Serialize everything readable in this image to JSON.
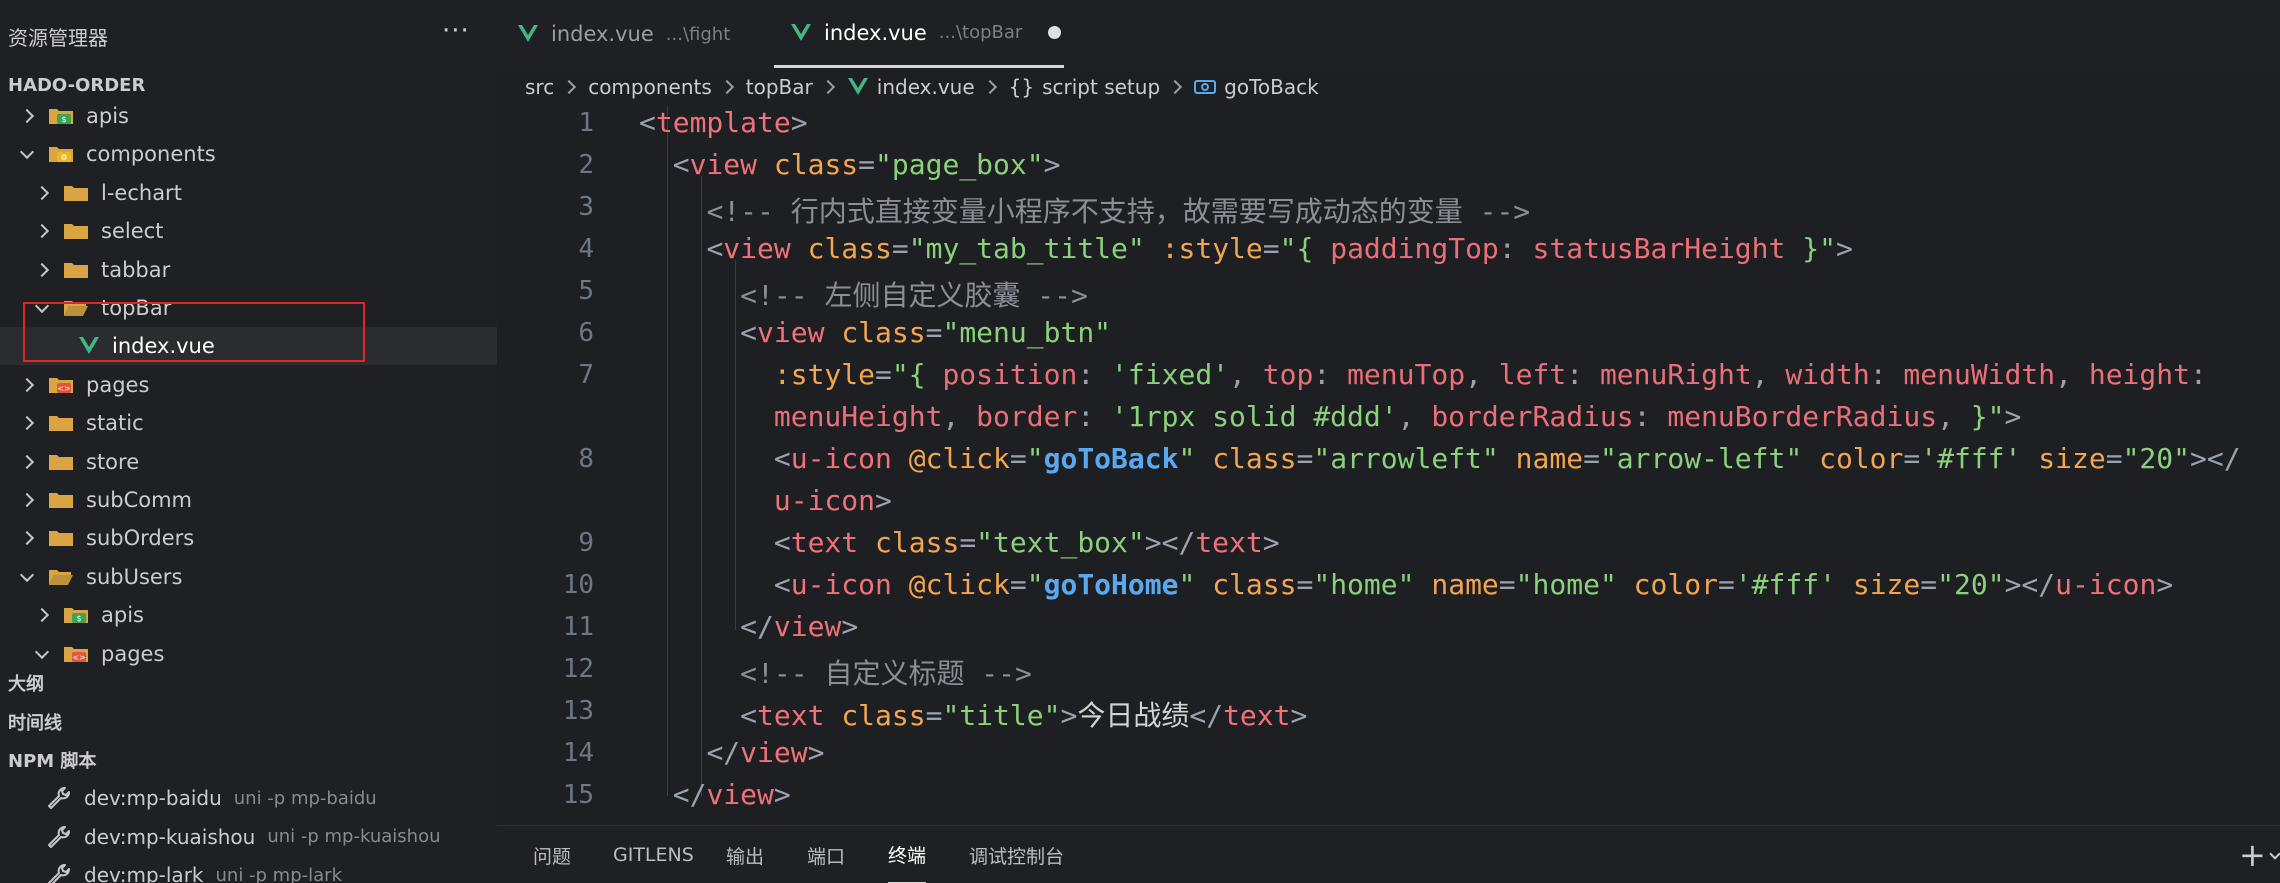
{
  "sidebar": {
    "title": "资源管理器",
    "more_icon": "ellipsis-icon",
    "project": "HADO-ORDER",
    "tree": [
      {
        "label": "apis",
        "kind": "api-folder",
        "open": false,
        "depth": 0
      },
      {
        "label": "components",
        "kind": "component-folder",
        "open": true,
        "depth": 0
      },
      {
        "label": "l-echart",
        "kind": "folder",
        "open": false,
        "depth": 1
      },
      {
        "label": "select",
        "kind": "folder",
        "open": false,
        "depth": 1
      },
      {
        "label": "tabbar",
        "kind": "folder",
        "open": false,
        "depth": 1
      },
      {
        "label": "topBar",
        "kind": "folder-open",
        "open": true,
        "depth": 1
      },
      {
        "label": "index.vue",
        "kind": "vue-file",
        "open": null,
        "depth": 2
      },
      {
        "label": "pages",
        "kind": "pages-folder",
        "open": false,
        "depth": 0
      },
      {
        "label": "static",
        "kind": "folder",
        "open": false,
        "depth": 0
      },
      {
        "label": "store",
        "kind": "folder",
        "open": false,
        "depth": 0
      },
      {
        "label": "subComm",
        "kind": "folder",
        "open": false,
        "depth": 0
      },
      {
        "label": "subOrders",
        "kind": "folder",
        "open": false,
        "depth": 0
      },
      {
        "label": "subUsers",
        "kind": "folder-open",
        "open": true,
        "depth": 0
      },
      {
        "label": "apis",
        "kind": "api-folder",
        "open": false,
        "depth": 1
      },
      {
        "label": "pages",
        "kind": "pages-folder",
        "open": true,
        "depth": 1
      }
    ],
    "sections": {
      "outline": "大纲",
      "timeline": "时间线",
      "npm": "NPM 脚本"
    },
    "npm_scripts": [
      {
        "name": "dev:mp-baidu",
        "cmd": "uni -p mp-baidu"
      },
      {
        "name": "dev:mp-kuaishou",
        "cmd": "uni -p mp-kuaishou"
      },
      {
        "name": "dev:mp-lark",
        "cmd": "uni -p mp-lark"
      }
    ]
  },
  "tabs": [
    {
      "name": "index.vue",
      "desc": "...\\fight",
      "active": false
    },
    {
      "name": "index.vue",
      "desc": "...\\topBar",
      "active": true,
      "dirty": true
    }
  ],
  "breadcrumb": {
    "parts": [
      "src",
      "components",
      "topBar"
    ],
    "file": "index.vue",
    "block": "script setup",
    "block_icon": "{}",
    "symbol": "goToBack"
  },
  "code_lines": [
    {
      "n": "1",
      "segs": [
        [
          "p",
          "<"
        ],
        [
          "t",
          "template"
        ],
        [
          "p",
          ">"
        ]
      ]
    },
    {
      "n": "2",
      "segs": [
        [
          "x",
          "  "
        ],
        [
          "p",
          "<"
        ],
        [
          "t",
          "view"
        ],
        [
          "x",
          " "
        ],
        [
          "a",
          "class"
        ],
        [
          "p",
          "="
        ],
        [
          "s",
          "\"page_box\""
        ],
        [
          "p",
          ">"
        ]
      ]
    },
    {
      "n": "3",
      "segs": [
        [
          "x",
          "    "
        ],
        [
          "c",
          "<!-- 行内式直接变量小程序不支持，故需要写成动态的变量 -->"
        ]
      ]
    },
    {
      "n": "4",
      "segs": [
        [
          "x",
          "    "
        ],
        [
          "p",
          "<"
        ],
        [
          "t",
          "view"
        ],
        [
          "x",
          " "
        ],
        [
          "a",
          "class"
        ],
        [
          "p",
          "="
        ],
        [
          "s",
          "\"my_tab_title\""
        ],
        [
          "x",
          " "
        ],
        [
          "a",
          ":style"
        ],
        [
          "p",
          "="
        ],
        [
          "s",
          "\"{ "
        ],
        [
          "v",
          "paddingTop"
        ],
        [
          "p",
          ": "
        ],
        [
          "v",
          "statusBarHeight"
        ],
        [
          "s",
          " }\""
        ],
        [
          "p",
          ">"
        ]
      ]
    },
    {
      "n": "5",
      "segs": [
        [
          "x",
          "      "
        ],
        [
          "c",
          "<!-- 左侧自定义胶囊 -->"
        ]
      ]
    },
    {
      "n": "6",
      "segs": [
        [
          "x",
          "      "
        ],
        [
          "p",
          "<"
        ],
        [
          "t",
          "view"
        ],
        [
          "x",
          " "
        ],
        [
          "a",
          "class"
        ],
        [
          "p",
          "="
        ],
        [
          "s",
          "\"menu_btn\""
        ]
      ]
    },
    {
      "n": "7",
      "segs": [
        [
          "x",
          "        "
        ],
        [
          "a",
          ":style"
        ],
        [
          "p",
          "="
        ],
        [
          "s",
          "\"{ "
        ],
        [
          "v",
          "position"
        ],
        [
          "p",
          ": "
        ],
        [
          "s",
          "'fixed'"
        ],
        [
          "p",
          ", "
        ],
        [
          "v",
          "top"
        ],
        [
          "p",
          ": "
        ],
        [
          "v",
          "menuTop"
        ],
        [
          "p",
          ", "
        ],
        [
          "v",
          "left"
        ],
        [
          "p",
          ": "
        ],
        [
          "v",
          "menuRight"
        ],
        [
          "p",
          ", "
        ],
        [
          "v",
          "width"
        ],
        [
          "p",
          ": "
        ],
        [
          "v",
          "menuWidth"
        ],
        [
          "p",
          ", "
        ],
        [
          "v",
          "height"
        ],
        [
          "p",
          ":"
        ]
      ]
    },
    {
      "n": "",
      "segs": [
        [
          "x",
          "        "
        ],
        [
          "v",
          "menuHeight"
        ],
        [
          "p",
          ", "
        ],
        [
          "v",
          "border"
        ],
        [
          "p",
          ": "
        ],
        [
          "s",
          "'1rpx solid #ddd'"
        ],
        [
          "p",
          ", "
        ],
        [
          "v",
          "borderRadius"
        ],
        [
          "p",
          ": "
        ],
        [
          "v",
          "menuBorderRadius"
        ],
        [
          "p",
          ", "
        ],
        [
          "s",
          "}\""
        ],
        [
          "p",
          ">"
        ]
      ]
    },
    {
      "n": "8",
      "segs": [
        [
          "x",
          "        "
        ],
        [
          "p",
          "<"
        ],
        [
          "t",
          "u-icon"
        ],
        [
          "x",
          " "
        ],
        [
          "a",
          "@click"
        ],
        [
          "p",
          "="
        ],
        [
          "s",
          "\""
        ],
        [
          "f",
          "goToBack"
        ],
        [
          "s",
          "\""
        ],
        [
          "x",
          " "
        ],
        [
          "a",
          "class"
        ],
        [
          "p",
          "="
        ],
        [
          "s",
          "\"arrowleft\""
        ],
        [
          "x",
          " "
        ],
        [
          "a",
          "name"
        ],
        [
          "p",
          "="
        ],
        [
          "s",
          "\"arrow-left\""
        ],
        [
          "x",
          " "
        ],
        [
          "a",
          "color"
        ],
        [
          "p",
          "="
        ],
        [
          "s",
          "'#fff'"
        ],
        [
          "x",
          " "
        ],
        [
          "a",
          "size"
        ],
        [
          "p",
          "="
        ],
        [
          "s",
          "\"20\""
        ],
        [
          "p",
          "></"
        ]
      ]
    },
    {
      "n": "",
      "segs": [
        [
          "x",
          "        "
        ],
        [
          "t",
          "u-icon"
        ],
        [
          "p",
          ">"
        ]
      ]
    },
    {
      "n": "9",
      "segs": [
        [
          "x",
          "        "
        ],
        [
          "p",
          "<"
        ],
        [
          "t",
          "text"
        ],
        [
          "x",
          " "
        ],
        [
          "a",
          "class"
        ],
        [
          "p",
          "="
        ],
        [
          "s",
          "\"text_box\""
        ],
        [
          "p",
          "></"
        ],
        [
          "t",
          "text"
        ],
        [
          "p",
          ">"
        ]
      ]
    },
    {
      "n": "10",
      "segs": [
        [
          "x",
          "        "
        ],
        [
          "p",
          "<"
        ],
        [
          "t",
          "u-icon"
        ],
        [
          "x",
          " "
        ],
        [
          "a",
          "@click"
        ],
        [
          "p",
          "="
        ],
        [
          "s",
          "\""
        ],
        [
          "f",
          "goToHome"
        ],
        [
          "s",
          "\""
        ],
        [
          "x",
          " "
        ],
        [
          "a",
          "class"
        ],
        [
          "p",
          "="
        ],
        [
          "s",
          "\"home\""
        ],
        [
          "x",
          " "
        ],
        [
          "a",
          "name"
        ],
        [
          "p",
          "="
        ],
        [
          "s",
          "\"home\""
        ],
        [
          "x",
          " "
        ],
        [
          "a",
          "color"
        ],
        [
          "p",
          "="
        ],
        [
          "s",
          "'#fff'"
        ],
        [
          "x",
          " "
        ],
        [
          "a",
          "size"
        ],
        [
          "p",
          "="
        ],
        [
          "s",
          "\"20\""
        ],
        [
          "p",
          "></"
        ],
        [
          "t",
          "u-icon"
        ],
        [
          "p",
          ">"
        ]
      ]
    },
    {
      "n": "11",
      "segs": [
        [
          "x",
          "      "
        ],
        [
          "p",
          "</"
        ],
        [
          "t",
          "view"
        ],
        [
          "p",
          ">"
        ]
      ]
    },
    {
      "n": "12",
      "segs": [
        [
          "x",
          "      "
        ],
        [
          "c",
          "<!-- 自定义标题 -->"
        ]
      ]
    },
    {
      "n": "13",
      "segs": [
        [
          "x",
          "      "
        ],
        [
          "p",
          "<"
        ],
        [
          "t",
          "text"
        ],
        [
          "x",
          " "
        ],
        [
          "a",
          "class"
        ],
        [
          "p",
          "="
        ],
        [
          "s",
          "\"title\""
        ],
        [
          "p",
          ">"
        ],
        [
          "x",
          "今日战绩"
        ],
        [
          "p",
          "</"
        ],
        [
          "t",
          "text"
        ],
        [
          "p",
          ">"
        ]
      ]
    },
    {
      "n": "14",
      "segs": [
        [
          "x",
          "    "
        ],
        [
          "p",
          "</"
        ],
        [
          "t",
          "view"
        ],
        [
          "p",
          ">"
        ]
      ]
    },
    {
      "n": "15",
      "segs": [
        [
          "x",
          "  "
        ],
        [
          "p",
          "</"
        ],
        [
          "t",
          "view"
        ],
        [
          "p",
          ">"
        ]
      ]
    }
  ],
  "panel": {
    "tabs": [
      {
        "label": "问题",
        "active": false
      },
      {
        "label": "GITLENS",
        "active": false
      },
      {
        "label": "输出",
        "active": false
      },
      {
        "label": "端口",
        "active": false
      },
      {
        "label": "终端",
        "active": true
      },
      {
        "label": "调试控制台",
        "active": false
      }
    ],
    "plus_label": "+"
  },
  "colors": {
    "vue_green": "#41b883",
    "folder": "#d9a441",
    "highlight_box": "#e02626"
  }
}
